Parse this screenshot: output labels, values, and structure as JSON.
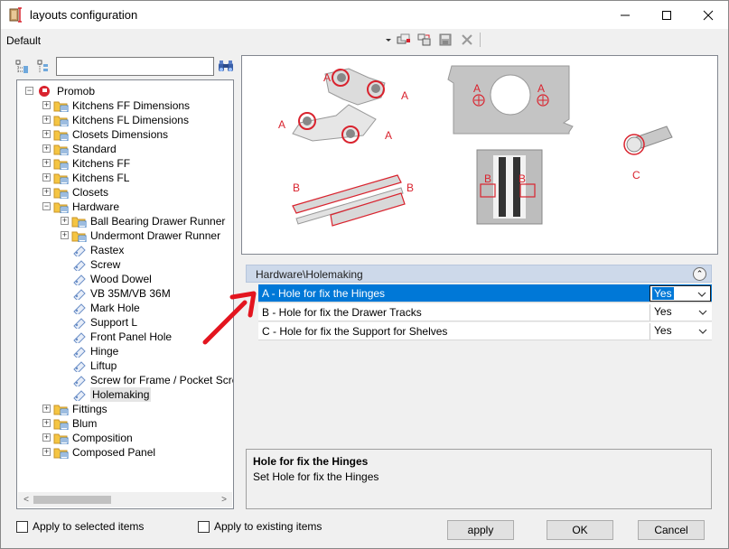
{
  "window": {
    "title": "layouts configuration",
    "controls": {
      "minimize": "—",
      "maximize": "☐",
      "close": "✕"
    }
  },
  "toolbar": {
    "configuration_name": "Default",
    "icons": [
      "dropdown-arrow-icon",
      "copy-icon",
      "paste-icon",
      "save-icon",
      "delete-icon"
    ]
  },
  "tree_toolbar": {
    "search_placeholder": "",
    "search_value": ""
  },
  "tree": {
    "root": "Promob",
    "items": [
      {
        "label": "Kitchens FF Dimensions",
        "level": 1,
        "type": "folder",
        "expander": "+"
      },
      {
        "label": "Kitchens FL Dimensions",
        "level": 1,
        "type": "folder",
        "expander": "+"
      },
      {
        "label": "Closets Dimensions",
        "level": 1,
        "type": "folder",
        "expander": "+"
      },
      {
        "label": "Standard",
        "level": 1,
        "type": "folder",
        "expander": "+"
      },
      {
        "label": "Kitchens FF",
        "level": 1,
        "type": "folder",
        "expander": "+"
      },
      {
        "label": "Kitchens FL",
        "level": 1,
        "type": "folder",
        "expander": "+"
      },
      {
        "label": "Closets",
        "level": 1,
        "type": "folder",
        "expander": "+"
      },
      {
        "label": "Hardware",
        "level": 1,
        "type": "folder",
        "expander": "−"
      },
      {
        "label": "Ball Bearing Drawer Runner",
        "level": 2,
        "type": "folder",
        "expander": "+"
      },
      {
        "label": "Undermont Drawer Runner",
        "level": 2,
        "type": "folder",
        "expander": "+"
      },
      {
        "label": "Rastex",
        "level": 2,
        "type": "item"
      },
      {
        "label": "Screw",
        "level": 2,
        "type": "item"
      },
      {
        "label": "Wood Dowel",
        "level": 2,
        "type": "item"
      },
      {
        "label": "VB 35M/VB 36M",
        "level": 2,
        "type": "item"
      },
      {
        "label": "Mark Hole",
        "level": 2,
        "type": "item"
      },
      {
        "label": "Support L",
        "level": 2,
        "type": "item"
      },
      {
        "label": "Front Panel Hole",
        "level": 2,
        "type": "item"
      },
      {
        "label": "Hinge",
        "level": 2,
        "type": "item"
      },
      {
        "label": "Liftup",
        "level": 2,
        "type": "item"
      },
      {
        "label": "Screw for Frame / Pocket Screw",
        "level": 2,
        "type": "item"
      },
      {
        "label": "Holemaking",
        "level": 2,
        "type": "item",
        "selected": true
      },
      {
        "label": "Fittings",
        "level": 1,
        "type": "folder",
        "expander": "+"
      },
      {
        "label": "Blum",
        "level": 1,
        "type": "folder",
        "expander": "+"
      },
      {
        "label": "Composition",
        "level": 1,
        "type": "folder",
        "expander": "+"
      },
      {
        "label": "Composed Panel",
        "level": 1,
        "type": "folder",
        "expander": "+"
      }
    ]
  },
  "preview": {
    "labels": {
      "a": "A",
      "b": "B",
      "c": "C"
    },
    "accent_color": "#d9232e"
  },
  "properties": {
    "category": "Hardware\\Holemaking",
    "rows": [
      {
        "name": "A - Hole for fix the Hinges",
        "value": "Yes",
        "selected": true
      },
      {
        "name": "B - Hole for fix the Drawer Tracks",
        "value": "Yes"
      },
      {
        "name": "C - Hole for fix the Support for Shelves",
        "value": "Yes"
      }
    ]
  },
  "description": {
    "title": "Hole for fix the Hinges",
    "text": "Set Hole for fix the Hinges"
  },
  "footer": {
    "apply_selected": "Apply to selected items",
    "apply_existing": "Apply to existing items",
    "apply_button": "apply",
    "ok_button": "OK",
    "cancel_button": "Cancel"
  },
  "colors": {
    "selection_blue": "#0078d7",
    "header_blue": "#cdd9ea",
    "annotation_red": "#e3151f"
  }
}
